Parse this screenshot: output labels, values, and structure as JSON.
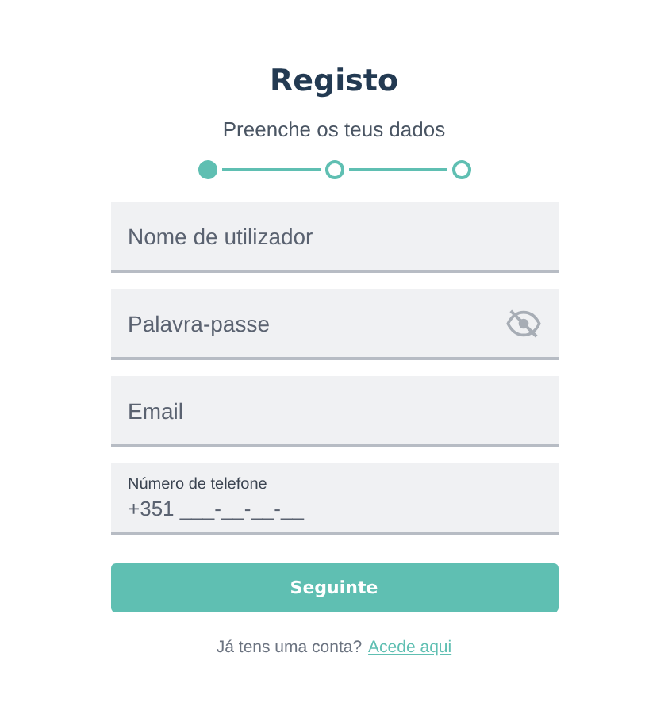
{
  "title": "Registo",
  "subtitle": "Preenche os teus dados",
  "steps": [
    {
      "selected": true
    },
    {
      "selected": false
    },
    {
      "selected": false
    }
  ],
  "fields": [
    {
      "kind": "text",
      "placeholder": "Nome de utilizador"
    },
    {
      "kind": "password",
      "placeholder": "Palavra-passe"
    },
    {
      "kind": "text",
      "placeholder": "Email"
    },
    {
      "kind": "phone",
      "label": "Número de telefone",
      "value": "+351 ___-__-__-__"
    }
  ],
  "button": "Seguinte",
  "footer": {
    "text": "Já tens uma conta?",
    "link": "Acede aqui"
  }
}
